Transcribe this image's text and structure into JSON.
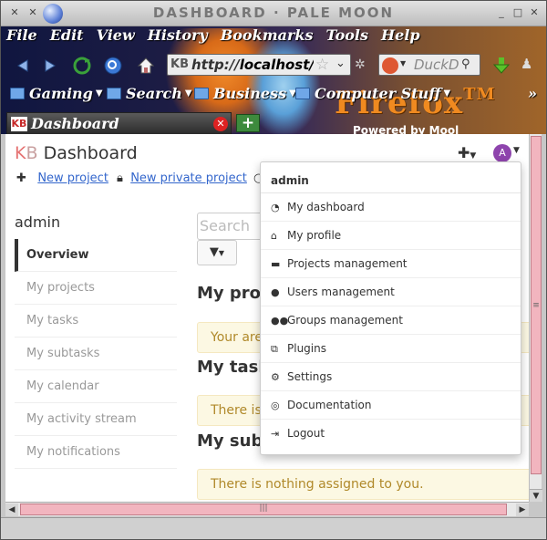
{
  "window": {
    "title": "DASHBOARD · PALE MOON",
    "menu": [
      "File",
      "Edit",
      "View",
      "History",
      "Bookmarks",
      "Tools",
      "Help"
    ],
    "url": {
      "scheme": "http://",
      "host": "localhost/ka",
      "favicon": "KB"
    },
    "search_placeholder": "DuckD",
    "bookmarks": [
      "Gaming",
      "Search",
      "Business",
      "Computer Stuff"
    ],
    "tab": {
      "favicon": "KB",
      "label": "Dashboard"
    },
    "theme": {
      "logo": "Firefox",
      "tm": "TM",
      "powered": "Powered by Mool"
    }
  },
  "page": {
    "brand_k": "K",
    "brand_b": "B",
    "title": "Dashboard",
    "avatar_letter": "A",
    "actions": {
      "new_project": "New project",
      "new_private_project": "New private project"
    },
    "sidebar_title": "admin",
    "sidebar_items": [
      "Overview",
      "My projects",
      "My tasks",
      "My subtasks",
      "My calendar",
      "My activity stream",
      "My notifications"
    ],
    "search_placeholder": "Search",
    "sections": [
      {
        "title": "My proj",
        "alert": "Your are"
      },
      {
        "title": "My task",
        "alert": "There is"
      },
      {
        "title": "My subt",
        "alert": "There is nothing assigned to you."
      }
    ]
  },
  "dropdown": {
    "header": "admin",
    "items": [
      {
        "label": "My dashboard",
        "icon": "dashboard-icon"
      },
      {
        "label": "My profile",
        "icon": "home-icon"
      },
      {
        "label": "Projects management",
        "icon": "folder-icon"
      },
      {
        "label": "Users management",
        "icon": "user-icon"
      },
      {
        "label": "Groups management",
        "icon": "users-icon"
      },
      {
        "label": "Plugins",
        "icon": "cubes-icon"
      },
      {
        "label": "Settings",
        "icon": "cog-icon"
      },
      {
        "label": "Documentation",
        "icon": "life-ring-icon"
      },
      {
        "label": "Logout",
        "icon": "sign-out-icon"
      }
    ]
  },
  "colors": {
    "accent_link": "#3366cc",
    "avatar": "#8e44ad",
    "alert_bg": "#fcf8e3",
    "alert_text": "#b0892a",
    "brand_k": "#e57373"
  }
}
